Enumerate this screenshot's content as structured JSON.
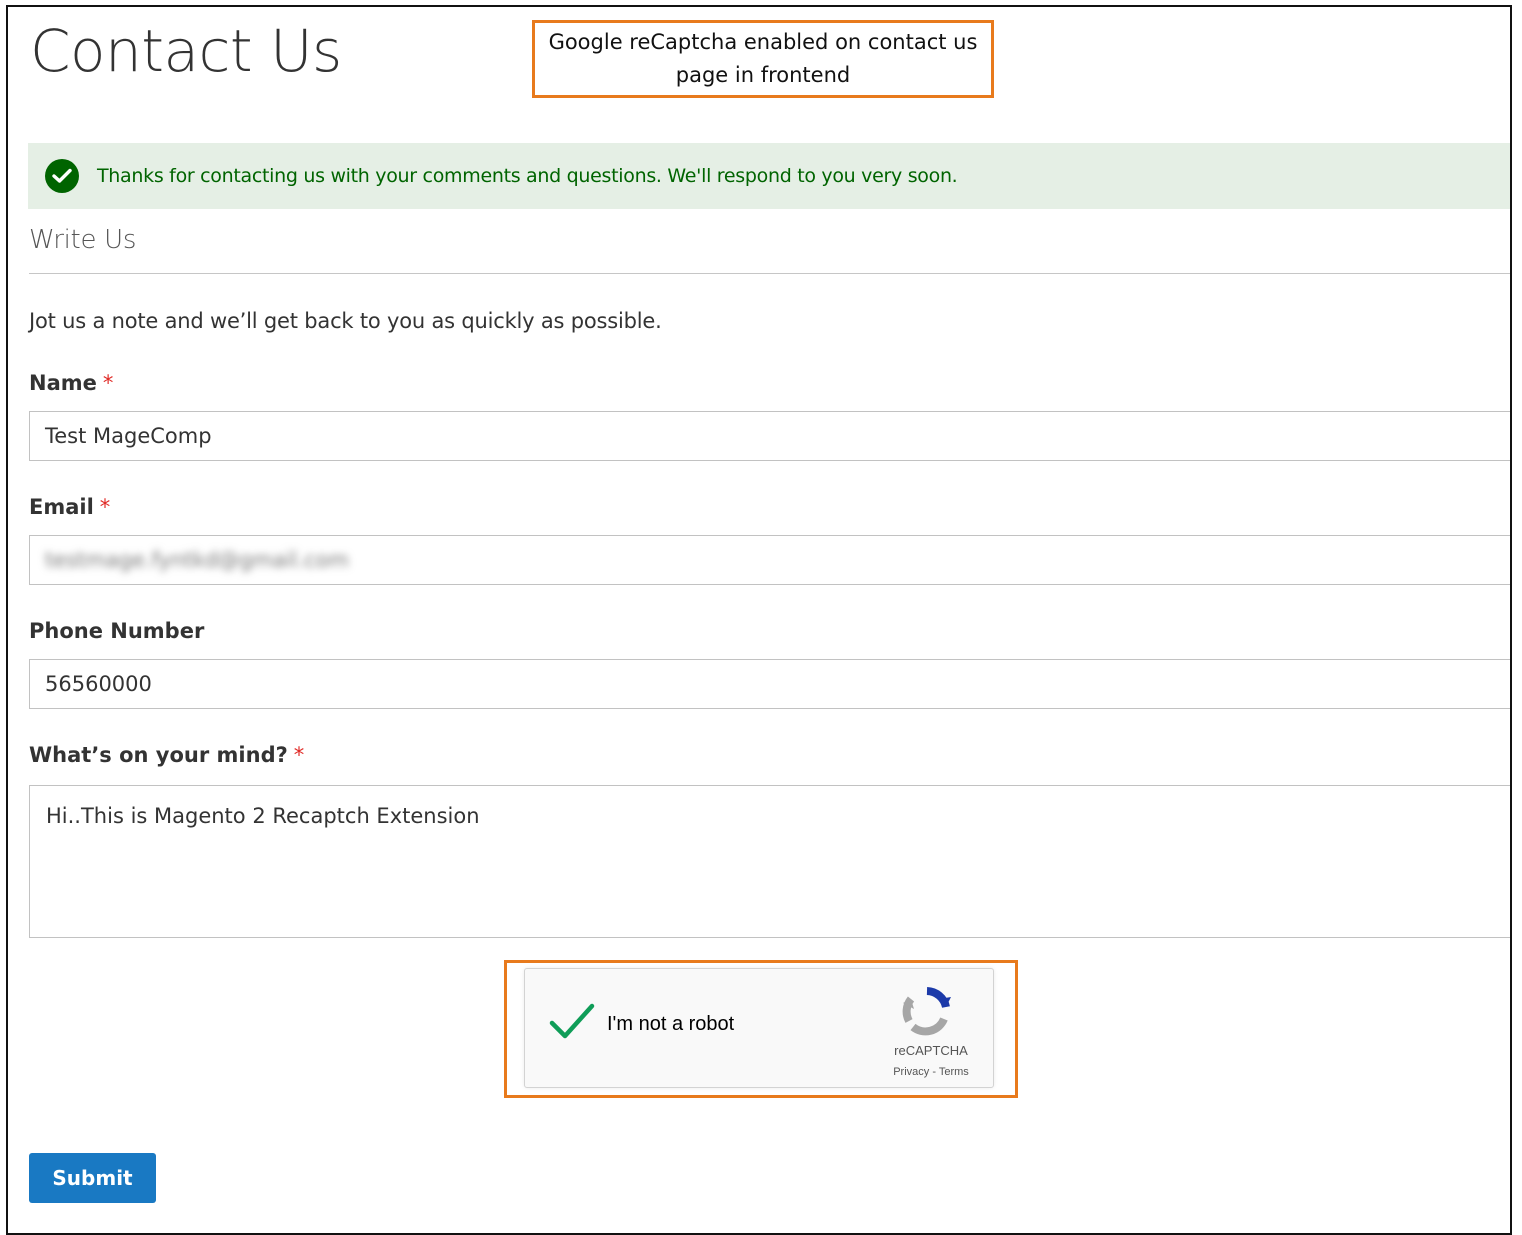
{
  "page": {
    "title": "Contact Us"
  },
  "annotation": {
    "text": "Google reCaptcha enabled on contact us page in frontend"
  },
  "success_message": {
    "text": "Thanks for contacting us with your comments and questions. We'll respond to you very soon.",
    "icon": "check-circle-icon",
    "color": "#006400"
  },
  "form": {
    "legend": "Write Us",
    "intro": "Jot us a note and we’ll get back to you as quickly as possible.",
    "name": {
      "label": "Name",
      "value": "Test MageComp",
      "required_mark": "*"
    },
    "email": {
      "label": "Email",
      "value": "testmage.fyntkd@gmail.com",
      "required_mark": "*"
    },
    "phone": {
      "label": "Phone Number",
      "value": "56560000"
    },
    "comment": {
      "label": "What’s on your mind?",
      "value": "Hi..This is Magento 2 Recaptch Extension",
      "required_mark": "*"
    },
    "submit_label": "Submit"
  },
  "recaptcha": {
    "checkbox_label": "I'm not a robot",
    "checked": true,
    "brand": "reCAPTCHA",
    "links": "Privacy - Terms"
  },
  "colors": {
    "accent": "#1979c3",
    "highlight": "#e87a1c",
    "required": "#e02b27",
    "success_bg": "#e5efe5"
  }
}
